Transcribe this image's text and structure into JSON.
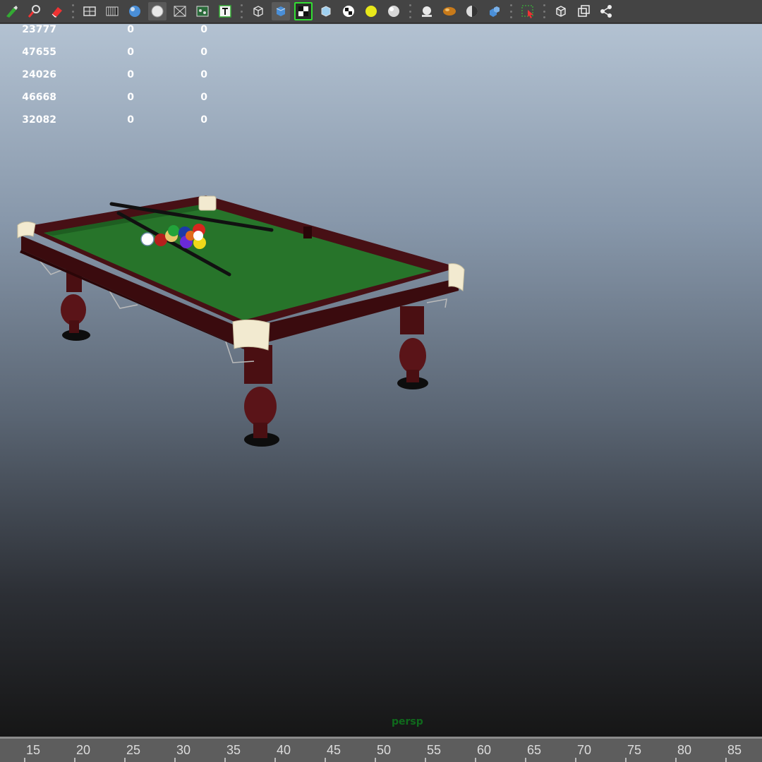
{
  "toolbar": {
    "groups": [
      [
        "brush-icon",
        "paint-effects-icon",
        "eraser-icon"
      ],
      [
        "grid-icon",
        "film-gate-icon",
        "shaded-sphere-icon",
        "wireframe-sphere-icon",
        "xray-icon",
        "uv-icon",
        "text-icon"
      ],
      [
        "wireframe-cube-icon",
        "smooth-shade-cube-icon",
        "checker-texture-icon",
        "bounding-cube-icon",
        "checker-ball-icon",
        "light-bulb-icon",
        "white-sphere-icon"
      ],
      [
        "ambient-light-icon",
        "bronze-sphere-icon",
        "half-shaded-sphere-icon",
        "blue-cubes-icon"
      ],
      [
        "select-camera-icon"
      ],
      [
        "cube-outline-icon",
        "isolate-icon",
        "share-icon"
      ]
    ],
    "active": [
      "wireframe-sphere-icon",
      "smooth-shade-cube-icon"
    ],
    "highlighted": [
      "checker-texture-icon"
    ]
  },
  "hud": {
    "rows": [
      [
        "23777",
        "0",
        "0"
      ],
      [
        "47655",
        "0",
        "0"
      ],
      [
        "24026",
        "0",
        "0"
      ],
      [
        "46668",
        "0",
        "0"
      ],
      [
        "32082",
        "0",
        "0"
      ]
    ]
  },
  "viewport": {
    "camera_label": "persp",
    "scene_object": "pool-table",
    "colors": {
      "felt": "#27742a",
      "wood": "#3e0e10",
      "pocket_caps": "#f2ead0",
      "label": "#0f6a1c"
    }
  },
  "timeline": {
    "ticks": [
      "15",
      "20",
      "25",
      "30",
      "35",
      "40",
      "45",
      "50",
      "55",
      "60",
      "65",
      "70",
      "75",
      "80",
      "85"
    ]
  }
}
